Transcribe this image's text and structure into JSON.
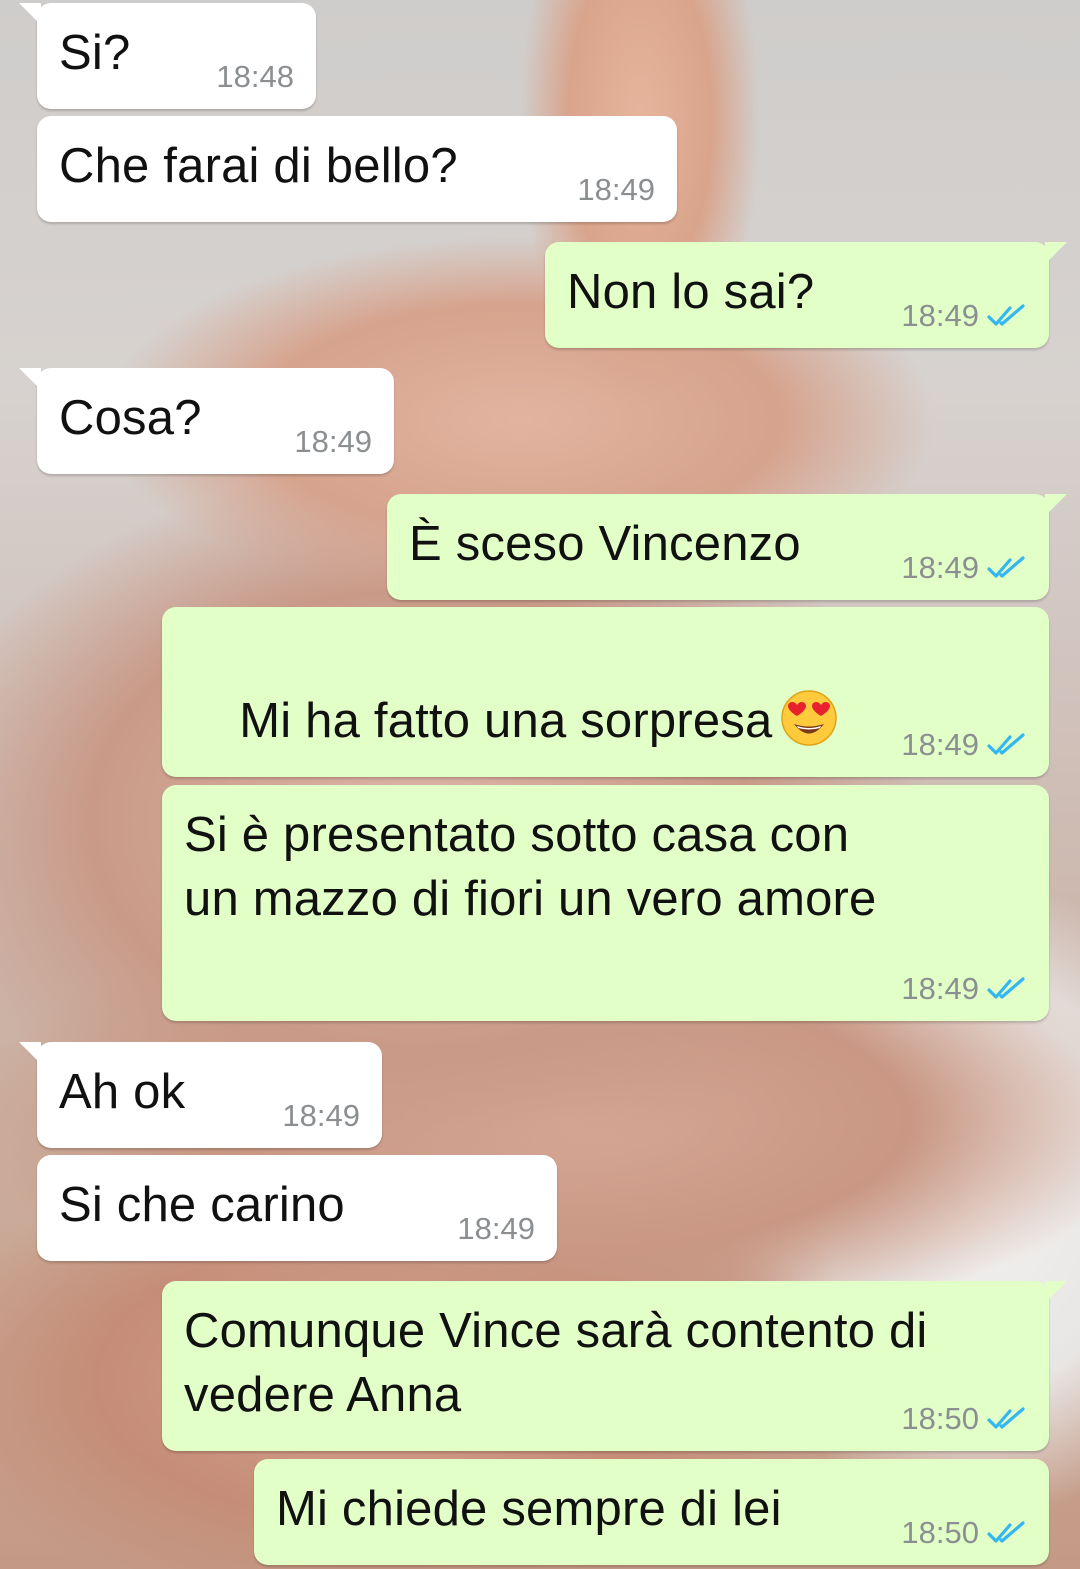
{
  "conversation": {
    "messages": [
      {
        "side": "in",
        "text": "Si?",
        "time": "18:48"
      },
      {
        "side": "in",
        "text": "Che farai di bello?",
        "time": "18:49"
      },
      {
        "side": "out",
        "text": "Non lo sai?",
        "time": "18:49",
        "status": "read"
      },
      {
        "side": "in",
        "text": "Cosa?",
        "time": "18:49"
      },
      {
        "side": "out",
        "text": "È sceso Vincenzo",
        "time": "18:49",
        "status": "read"
      },
      {
        "side": "out",
        "text": "Mi ha fatto una sorpresa",
        "emoji": "heart-eyes-emoji",
        "time": "18:49",
        "status": "read"
      },
      {
        "side": "out",
        "text_lines": [
          "Si è presentato sotto casa con",
          "un mazzo di fiori un vero amore"
        ],
        "time": "18:49",
        "status": "read"
      },
      {
        "side": "in",
        "text": "Ah ok",
        "time": "18:49"
      },
      {
        "side": "in",
        "text": "Si che carino",
        "time": "18:49"
      },
      {
        "side": "out",
        "text_lines": [
          "Comunque Vince sarà contento di",
          "vedere Anna"
        ],
        "time": "18:50",
        "status": "read"
      },
      {
        "side": "out",
        "text": "Mi chiede sempre di lei",
        "time": "18:50",
        "status": "read"
      }
    ]
  },
  "colors": {
    "incoming_bubble": "#ffffff",
    "outgoing_bubble": "#e1ffc7",
    "read_ticks": "#34b7f1",
    "timestamp": "#8b8f91"
  }
}
